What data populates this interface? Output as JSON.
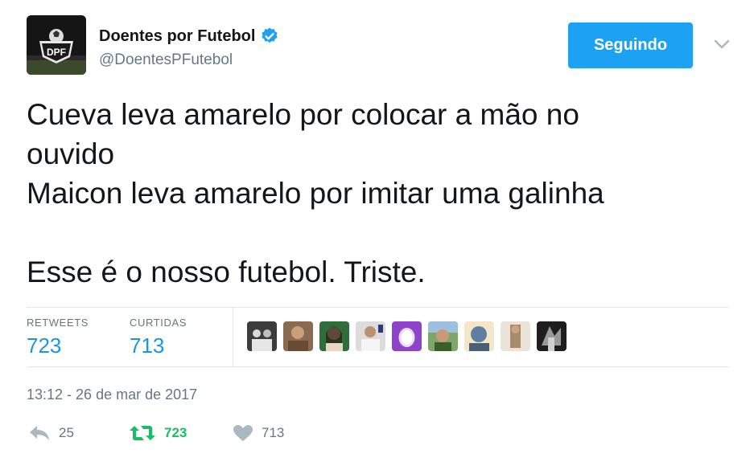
{
  "account": {
    "display_name": "Doentes por Futebol",
    "handle": "@DoentesPFutebol",
    "avatar_text": "DPF",
    "verified_icon": "verified-badge-icon"
  },
  "follow_button": {
    "label": "Seguindo"
  },
  "tweet": {
    "lines": [
      "Cueva leva amarelo por colocar a mão no ouvido",
      "Maicon leva amarelo por imitar uma galinha",
      "",
      "Esse é o nosso futebol. Triste."
    ]
  },
  "stats": {
    "retweets_label": "RETWEETS",
    "retweets_value": "723",
    "likes_label": "CURTIDAS",
    "likes_value": "713"
  },
  "timestamp": "13:12 - 26 de mar de 2017",
  "actions": {
    "reply_count": "25",
    "retweet_count": "723",
    "like_count": "713"
  },
  "colors": {
    "accent": "#1da1f2",
    "link_blue": "#1b95e0",
    "retweet_green": "#17bf63",
    "muted": "#657786"
  }
}
